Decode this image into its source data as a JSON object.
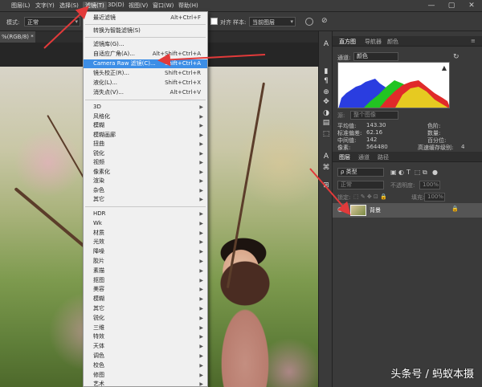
{
  "menubar": {
    "items": [
      "图层(L)",
      "文字(Y)",
      "选择(S)",
      "滤镜(T)",
      "3D(D)",
      "视图(V)",
      "窗口(W)",
      "帮助(H)"
    ],
    "active_index": 3,
    "minimize": "—",
    "maximize": "▢",
    "close": "✕"
  },
  "options": {
    "mode_label": "模式:",
    "mode_value": "正常",
    "align_label": "对齐",
    "sample_label": "样本:",
    "sample_value": "当前图层"
  },
  "tab": {
    "label": "%(RGB/8) *",
    "close": "×"
  },
  "filter_menu": {
    "top": [
      {
        "label": "最近滤镜",
        "shortcut": "Alt+Ctrl+F"
      },
      {
        "label": "转换为智能滤镜(S)",
        "shortcut": ""
      }
    ],
    "group2": [
      {
        "label": "滤镜库(G)...",
        "shortcut": ""
      },
      {
        "label": "自适应广角(A)...",
        "shortcut": "Alt+Shift+Ctrl+A"
      },
      {
        "label": "Camera Raw 滤镜(C)...",
        "shortcut": "Shift+Ctrl+A",
        "highlighted": true
      },
      {
        "label": "镜头校正(R)...",
        "shortcut": "Shift+Ctrl+R"
      },
      {
        "label": "液化(L)...",
        "shortcut": "Shift+Ctrl+X"
      },
      {
        "label": "消失点(V)...",
        "shortcut": "Alt+Ctrl+V"
      }
    ],
    "group3": [
      "3D",
      "风格化",
      "模糊",
      "模糊画廊",
      "扭曲",
      "锐化",
      "视频",
      "像素化",
      "渲染",
      "杂色",
      "其它"
    ],
    "group4": [
      "HDR",
      "Wk",
      "材质",
      "光效",
      "降噪",
      "胶片",
      "素描",
      "抠图",
      "美容",
      "模糊",
      "其它",
      "锐化",
      "三维",
      "特效",
      "天体",
      "调色",
      "校色",
      "修图",
      "艺术"
    ]
  },
  "toolstrip": [
    "A",
    "▮",
    "¶",
    "⊕",
    "✥",
    "◑",
    "▤",
    "⬚",
    "A",
    "⌘",
    "⊞"
  ],
  "histogram_panel": {
    "tabs": [
      "直方图",
      "导航器",
      "颜色"
    ],
    "channel_label": "通道:",
    "channel_value": "颜色",
    "source_label": "源:",
    "source_value": "整个图像",
    "stats_left": [
      {
        "label": "平均值:",
        "value": "143.30"
      },
      {
        "label": "标准偏差:",
        "value": "62.16"
      },
      {
        "label": "中间值:",
        "value": "142"
      },
      {
        "label": "像素:",
        "value": "564480"
      }
    ],
    "stats_right": [
      {
        "label": "色阶:",
        "value": ""
      },
      {
        "label": "数量:",
        "value": ""
      },
      {
        "label": "百分位:",
        "value": ""
      },
      {
        "label": "高速缓存级别:",
        "value": "4"
      }
    ],
    "warning": "▲"
  },
  "layers_panel": {
    "tabs": [
      "图层",
      "通道",
      "路径"
    ],
    "kind_label": "ρ 类型",
    "blend_value": "正常",
    "opacity_label": "不透明度:",
    "opacity_value": "100%",
    "lock_label": "锁定:",
    "fill_label": "填充:",
    "fill_value": "100%",
    "layer_name": "背景",
    "lock_icon": "🔒",
    "eye_icon": "◉"
  },
  "watermark": "头条号 / 蚂蚁本摄",
  "colors": {
    "highlight": "#3d8ee6",
    "arrow": "#e23a3a"
  }
}
